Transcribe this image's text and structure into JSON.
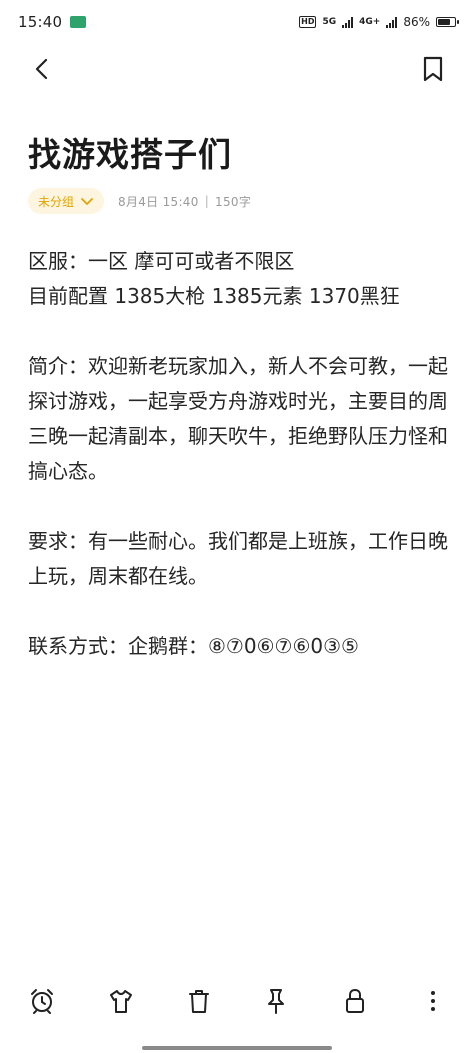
{
  "status_bar": {
    "time": "15:40",
    "hd_label": "HD",
    "net1": "5G",
    "net2": "4G+",
    "battery_percent": "86%",
    "battery_level": 0.86
  },
  "nav": {
    "back_icon": "chevron-left-icon",
    "bookmark_icon": "bookmark-icon"
  },
  "note": {
    "title": "找游戏搭子们",
    "category": "未分组",
    "date": "8月4日 15:40",
    "separator": "|",
    "word_count": "150字",
    "paragraphs": [
      "区服：一区 摩可可或者不限区\n目前配置 1385大枪 1385元素 1370黑狂",
      "简介：欢迎新老玩家加入，新人不会可教，一起探讨游戏，一起享受方舟游戏时光，主要目的周三晚一起清副本，聊天吹牛，拒绝野队压力怪和搞心态。",
      "要求：有一些耐心。我们都是上班族，工作日晚上玩，周末都在线。",
      "联系方式：企鹅群：⑧⑦0⑥⑦⑥0③⑤"
    ]
  },
  "toolbar": {
    "icons": [
      "alarm-icon",
      "tshirt-icon",
      "trash-icon",
      "pin-icon",
      "lock-icon",
      "more-vertical-icon"
    ]
  },
  "colors": {
    "accent": "#e0a400",
    "chip_bg": "#fdf5e0",
    "text": "#262626",
    "meta": "#9a9a9a"
  }
}
